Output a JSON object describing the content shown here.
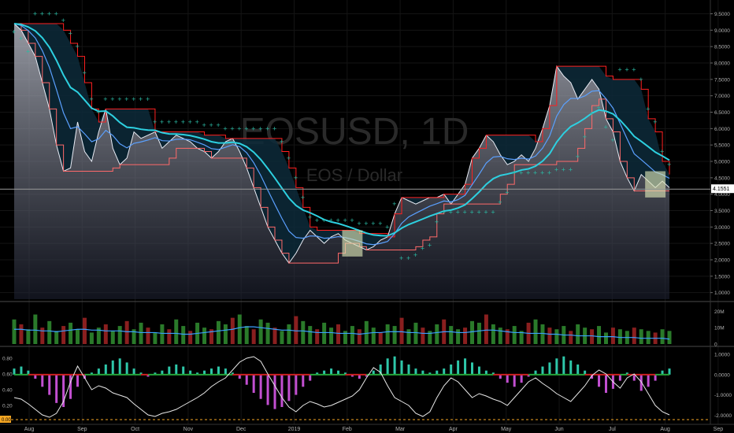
{
  "chart_data": {
    "type": "line",
    "symbol": "EOSUSD, 1D",
    "subtitle": "EOS / Dollar",
    "last_price": "4.1551",
    "price_axis": {
      "ticks": [
        "9.5000",
        "9.0000",
        "8.5000",
        "8.0000",
        "7.5000",
        "7.0000",
        "6.5000",
        "6.0000",
        "5.5000",
        "5.0000",
        "4.5000",
        "4.0000",
        "3.5000",
        "3.0000",
        "2.5000",
        "2.0000",
        "1.5000",
        "1.0000"
      ],
      "ylim": [
        0.8,
        9.8
      ]
    },
    "x_axis": {
      "labels": [
        "Aug",
        "Sep",
        "Oct",
        "Nov",
        "Dec",
        "2019",
        "Feb",
        "Mar",
        "Apr",
        "May",
        "Jun",
        "Jul",
        "Aug",
        "Sep"
      ]
    },
    "series": [
      {
        "kind": "close",
        "values": [
          9.2,
          9.0,
          8.6,
          8.2,
          7.4,
          6.6,
          5.5,
          4.7,
          4.8,
          6.2,
          5.3,
          5.0,
          5.9,
          6.6,
          5.4,
          4.9,
          5.1,
          5.9,
          5.7,
          5.8,
          5.9,
          5.4,
          5.6,
          5.8,
          5.7,
          5.6,
          5.4,
          5.3,
          5.1,
          5.3,
          5.6,
          5.7,
          5.3,
          4.8,
          4.2,
          3.6,
          3.0,
          2.6,
          2.2,
          1.9,
          2.2,
          2.6,
          2.9,
          2.7,
          2.5,
          2.7,
          2.8,
          2.6,
          2.5,
          2.4,
          2.3,
          2.4,
          2.6,
          2.7,
          3.4,
          3.9,
          3.8,
          3.7,
          3.8,
          3.9,
          3.9,
          4.0,
          3.7,
          4.0,
          4.3,
          5.1,
          5.4,
          5.8,
          5.6,
          5.2,
          4.9,
          5.0,
          5.2,
          5.0,
          5.4,
          6.0,
          6.7,
          7.9,
          7.6,
          7.4,
          6.9,
          7.2,
          7.5,
          7.2,
          6.3,
          5.9,
          5.0,
          4.5,
          4.1,
          4.6,
          4.4,
          4.2,
          4.4,
          4.2
        ]
      }
    ],
    "volume_pane": {
      "axis_ticks": [
        "20M",
        "10M",
        "0"
      ],
      "ylim": [
        0,
        24000000
      ],
      "volume_values": [
        15,
        12,
        9,
        18,
        10,
        14,
        8,
        11,
        13,
        9,
        16,
        7,
        10,
        12,
        8,
        11,
        14,
        9,
        13,
        10,
        7,
        12,
        9,
        15,
        11,
        8,
        13,
        10,
        9,
        14,
        12,
        16,
        18,
        11,
        9,
        15,
        13,
        10,
        8,
        12,
        17,
        14,
        11,
        9,
        13,
        10,
        12,
        8,
        11,
        9,
        14,
        10,
        7,
        12,
        11,
        16,
        9,
        13,
        10,
        8,
        12,
        15,
        11,
        9,
        10,
        14,
        13,
        18,
        12,
        10,
        9,
        11,
        8,
        13,
        15,
        12,
        10,
        9,
        11,
        8,
        12,
        10,
        9,
        11,
        7,
        10,
        9,
        8,
        10,
        9,
        8,
        7,
        9,
        8
      ],
      "average_values": [
        9,
        9,
        8.5,
        8.5,
        8,
        8,
        7.5,
        8,
        8.5,
        9,
        9,
        8.5,
        8.5,
        8,
        8,
        8,
        7.5,
        7.5,
        7,
        7,
        7,
        6.5,
        6.5,
        6.5,
        6,
        6,
        6.5,
        7,
        7.5,
        8,
        8.5,
        9,
        10,
        10.5,
        10.5,
        10,
        9.5,
        9,
        8.5,
        8.5,
        8,
        8,
        7.5,
        7,
        7,
        7,
        6.5,
        6.5,
        6.5,
        6,
        6.5,
        7,
        7,
        7.5,
        7.5,
        7.5,
        7,
        7,
        6.5,
        6.5,
        7,
        7.5,
        7.5,
        7,
        7,
        7.5,
        8,
        8.5,
        8.5,
        8,
        7.5,
        7,
        7,
        6.5,
        6.5,
        6.5,
        6,
        6,
        5.5,
        5.5,
        5,
        5,
        5,
        4.5,
        4.5,
        4.5,
        4,
        4,
        4,
        3.5,
        3.5,
        3.5,
        3.5,
        3
      ]
    },
    "oscillator_pane": {
      "left_axis_ticks": [
        "0.80",
        "0.60",
        "0.40",
        "0.20",
        "0.00"
      ],
      "right_axis_ticks": [
        "1.0000",
        "0.0000",
        "-1.0000",
        "-2.0000"
      ],
      "left_ylim": [
        0,
        0.9
      ],
      "right_ylim": [
        -2.3,
        1.2
      ],
      "histogram_values": [
        0.3,
        0.4,
        0.2,
        -0.2,
        -0.6,
        -1.0,
        -1.4,
        -1.6,
        -1.2,
        -0.6,
        -0.2,
        0.1,
        0.3,
        0.5,
        0.7,
        0.8,
        0.6,
        0.3,
        0.1,
        -0.1,
        0.1,
        0.2,
        0.4,
        0.5,
        0.4,
        0.2,
        0.1,
        0.2,
        0.3,
        0.4,
        0.3,
        0.1,
        -0.2,
        -0.5,
        -0.9,
        -1.2,
        -1.5,
        -1.7,
        -1.6,
        -1.3,
        -1.0,
        -0.6,
        -0.3,
        0.1,
        0.2,
        0.3,
        0.2,
        0.1,
        -0.1,
        -0.2,
        -0.1,
        0.2,
        0.5,
        0.8,
        0.9,
        0.7,
        0.5,
        0.3,
        0.2,
        0.1,
        0.2,
        0.3,
        0.5,
        0.7,
        0.8,
        0.6,
        0.4,
        0.2,
        0.1,
        -0.2,
        -0.4,
        -0.6,
        -0.4,
        -0.1,
        0.2,
        0.4,
        0.6,
        0.8,
        0.9,
        0.7,
        0.5,
        0.2,
        -0.2,
        -0.6,
        -0.9,
        -0.7,
        -0.3,
        0.1,
        -0.3,
        -0.8,
        -0.6,
        -0.3,
        0.2,
        0.3
      ],
      "line_values": [
        0.3,
        0.28,
        0.22,
        0.15,
        0.08,
        0.05,
        0.1,
        0.25,
        0.5,
        0.7,
        0.55,
        0.4,
        0.45,
        0.42,
        0.36,
        0.33,
        0.3,
        0.22,
        0.15,
        0.08,
        0.06,
        0.1,
        0.12,
        0.15,
        0.2,
        0.25,
        0.3,
        0.36,
        0.44,
        0.5,
        0.55,
        0.65,
        0.75,
        0.8,
        0.82,
        0.76,
        0.6,
        0.45,
        0.3,
        0.18,
        0.12,
        0.2,
        0.25,
        0.22,
        0.18,
        0.2,
        0.24,
        0.28,
        0.32,
        0.4,
        0.55,
        0.68,
        0.62,
        0.45,
        0.3,
        0.25,
        0.2,
        0.1,
        0.06,
        0.12,
        0.3,
        0.45,
        0.55,
        0.5,
        0.4,
        0.3,
        0.35,
        0.32,
        0.28,
        0.25,
        0.2,
        0.3,
        0.4,
        0.5,
        0.55,
        0.48,
        0.42,
        0.35,
        0.3,
        0.25,
        0.35,
        0.45,
        0.58,
        0.65,
        0.6,
        0.5,
        0.42,
        0.55,
        0.6,
        0.5,
        0.35,
        0.2,
        0.12,
        0.08
      ],
      "threshold_value": 0.02,
      "current_value": "0.00"
    },
    "colors": {
      "background": "#000000",
      "price_fill": "#c8ccd8",
      "channel_upper": "#ff2020",
      "channel_lower": "#ff6a6a",
      "sar_dots": "#2bb9a3",
      "ema_fast": "#5aa0ff",
      "ema_slow": "#2dd0e0",
      "volume_up": "#2a7a2a",
      "volume_down": "#8a1f1f",
      "volume_avg": "#3aa0ff",
      "hist_pos": "#2ec7a9",
      "hist_neg": "#c24fd1",
      "zero_line_pos": "#25a53a",
      "zero_line_neg": "#cc2020",
      "highlight_box": "#d9e2b3",
      "price_label": "#ffffff",
      "osc_label_bg": "#f5a623"
    }
  }
}
